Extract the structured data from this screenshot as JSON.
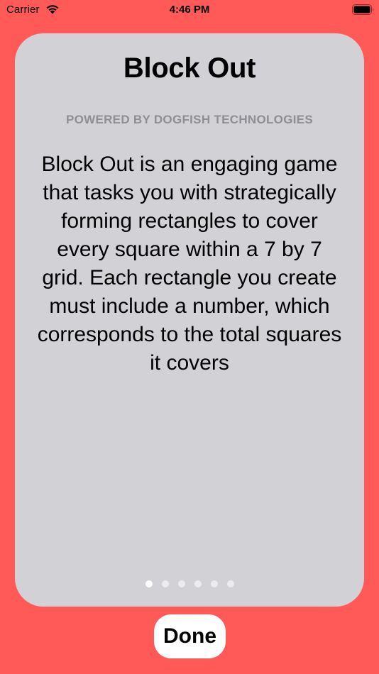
{
  "status_bar": {
    "carrier": "Carrier",
    "time": "4:46 PM",
    "icons": [
      "wifi-icon",
      "battery-icon"
    ]
  },
  "card": {
    "title": "Block Out",
    "subtitle": "POWERED BY DOGFISH TECHNOLOGIES",
    "description": "Block Out is an engaging game that tasks you with strategically forming rectangles to cover every square within a 7 by 7 grid. Each rectangle you create must include a number, which corresponds to the total squares it covers",
    "page_indicator": {
      "total_pages": 6,
      "current_page": 1
    }
  },
  "done_button": {
    "label": "Done"
  },
  "colors": {
    "background": "#ff5a58",
    "card": "#d1d1d6",
    "subtitle": "#8e8e93",
    "button": "#ffffff"
  }
}
